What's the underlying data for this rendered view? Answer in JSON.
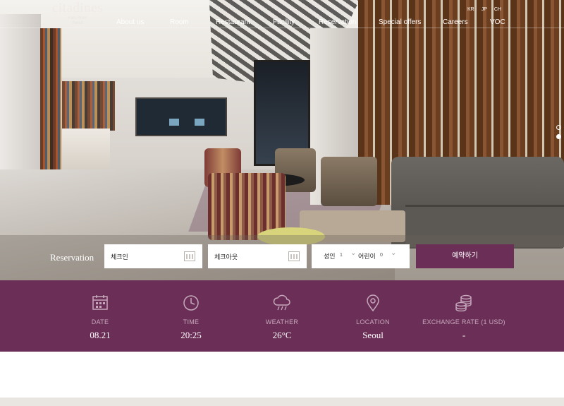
{
  "brand": {
    "name": "citadines",
    "sub1": "Han River",
    "sub2": "Seoul"
  },
  "nav": {
    "items": [
      "About us",
      "Room",
      "Restaurant",
      "Facility",
      "Reservation",
      "Special offers",
      "Careers",
      "VOC"
    ]
  },
  "languages": [
    "KR",
    "JP",
    "CH"
  ],
  "slider": {
    "dots": 2,
    "active_index": 1
  },
  "reservation": {
    "label": "Reservation",
    "checkin_placeholder": "체크인",
    "checkout_placeholder": "체크아웃",
    "adults_label": "성인",
    "adults_value": "1",
    "children_label": "어린이",
    "children_value": "0",
    "book_button": "예약하기"
  },
  "info": {
    "date": {
      "label": "DATE",
      "value": "08.21",
      "icon": "calendar-icon"
    },
    "time": {
      "label": "TIME",
      "value": "20:25",
      "icon": "clock-icon"
    },
    "weather": {
      "label": "WEATHER",
      "value": "26°C",
      "icon": "rain-cloud-icon"
    },
    "location": {
      "label": "LOCATION",
      "value": "Seoul",
      "icon": "map-pin-icon"
    },
    "exchange": {
      "label": "EXCHANGE RATE (1 USD)",
      "value": "-",
      "icon": "coins-icon"
    }
  },
  "colors": {
    "brand_purple": "#6b2f57",
    "label_purple": "#c6a9bc"
  }
}
